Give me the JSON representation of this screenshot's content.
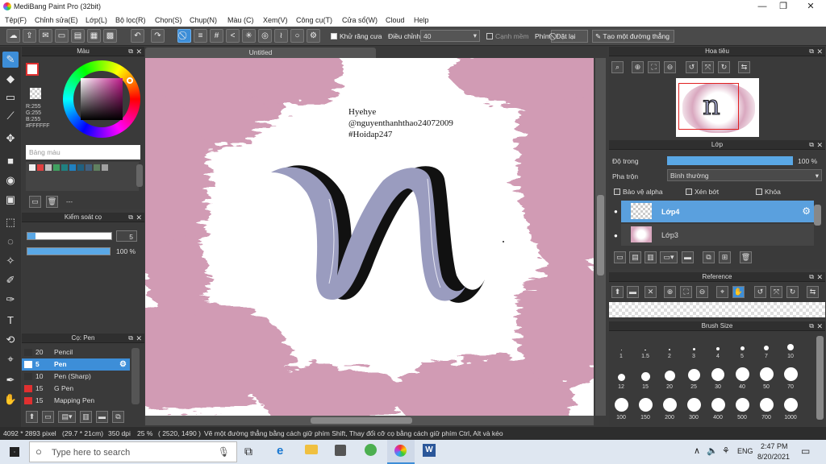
{
  "window": {
    "title": "MediBang Paint Pro (32bit)"
  },
  "menu": [
    "Tệp(F)",
    "Chỉnh sửa(E)",
    "Lớp(L)",
    "Bộ lọc(R)",
    "Chọn(S)",
    "Chụp(N)",
    "Màu (C)",
    "Xem(V)",
    "Công cụ(T)",
    "Cửa sổ(W)",
    "Cloud",
    "Help"
  ],
  "toolbar": {
    "antialias_label": "Khử răng cưa",
    "adjust_label": "Điều chỉnh",
    "adjust_value": "40",
    "sharp_edge_label": "Cạnh mềm",
    "pen_label": "Phím",
    "reset_label": "Đặt lại",
    "straight_line_label": "Tạo một đường thẳng"
  },
  "canvas": {
    "tab_title": "Untitled",
    "text_lines": [
      "Hyehye",
      "@nguyenthanhthao24072009",
      "#Hoidap247"
    ]
  },
  "color_panel": {
    "title": "Màu",
    "r": "R:255",
    "g": "G:255",
    "b": "B:255",
    "hex": "#FFFFFF",
    "palette_label": "Bảng màu",
    "swatches": [
      "#f0f0f0",
      "#e04040",
      "#c0c0c0",
      "#40a060",
      "#208080",
      "#2080c0",
      "#206080",
      "#406080",
      "#608060",
      "#a0a0a0"
    ],
    "palette_footer": "---"
  },
  "brush_control": {
    "title": "Kiểm soát cọ",
    "size_value": "5",
    "opacity_value": "100 %",
    "size_fraction": 0.1,
    "opacity_fraction": 1.0
  },
  "brush_list": {
    "title": "Cọ: Pen",
    "items": [
      {
        "size": "20",
        "name": "Pencil",
        "color": "#333333"
      },
      {
        "size": "5",
        "name": "Pen",
        "color": "#ffffff"
      },
      {
        "size": "10",
        "name": "Pen (Sharp)",
        "color": "#333333"
      },
      {
        "size": "15",
        "name": "G Pen",
        "color": "#e03030"
      },
      {
        "size": "15",
        "name": "Mapping Pen",
        "color": "#e03030"
      }
    ]
  },
  "navigator": {
    "title": "Hoa tiêu"
  },
  "layer_panel": {
    "title": "Lớp",
    "opacity_label": "Độ trong",
    "opacity_value": "100 %",
    "opacity_fraction": 1.0,
    "blend_label": "Pha trộn",
    "blend_value": "Bình thường",
    "protect_alpha": "Bảo vệ alpha",
    "clipping": "Xén bớt",
    "lock": "Khóa",
    "layers": [
      {
        "name": "Lớp4",
        "selected": true
      },
      {
        "name": "Lớp3",
        "selected": false
      }
    ]
  },
  "reference": {
    "title": "Reference"
  },
  "brush_size": {
    "title": "Brush Size",
    "sizes": [
      "1",
      "1.5",
      "2",
      "3",
      "4",
      "5",
      "7",
      "10",
      "12",
      "15",
      "20",
      "25",
      "30",
      "40",
      "50",
      "70",
      "100",
      "150",
      "200",
      "300",
      "400",
      "500",
      "700",
      "1000"
    ]
  },
  "status": {
    "dimensions": "4092 * 2893 pixel",
    "physical": "(29.7 * 21cm)",
    "dpi": "350 dpi",
    "zoom": "25 %",
    "coords": "( 2520, 1490 )",
    "hint": "Vẽ một đường thẳng bằng cách giữ phím Shift, Thay đổi cỡ cọ bằng cách giữ phím Ctrl, Alt và kéo"
  },
  "taskbar": {
    "search_placeholder": "Type here to search",
    "lang": "ENG",
    "time": "2:47 PM",
    "date": "8/20/2021"
  },
  "colors": {
    "accent": "#3d8ed8",
    "panel": "#3a3a3a",
    "brush_pink": "#c98aa8",
    "letter_fill": "#9a9cbf"
  }
}
